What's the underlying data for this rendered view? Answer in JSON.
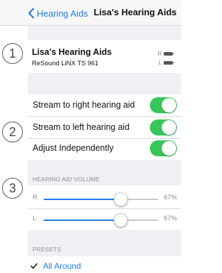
{
  "nav": {
    "back_label": "Hearing Aids",
    "title": "Lisa's Hearing Aids"
  },
  "device": {
    "name": "Lisa's Hearing Aids",
    "model": "ReSound LiNX TS 961",
    "battery_right_label": "R",
    "battery_left_label": "L"
  },
  "streaming": {
    "items": [
      {
        "label": "Stream to right hearing aid",
        "on": true
      },
      {
        "label": "Stream to left hearing aid",
        "on": true
      },
      {
        "label": "Adjust Independently",
        "on": true
      }
    ]
  },
  "volume": {
    "header": "HEARING AID VOLUME",
    "right": {
      "side": "R",
      "percent_label": "67%",
      "value": 0.67
    },
    "left": {
      "side": "L",
      "percent_label": "67%",
      "value": 0.67
    }
  },
  "presets": {
    "header": "PRESETS",
    "selected": "All Around"
  },
  "callouts": [
    "1",
    "2",
    "3"
  ],
  "colors": {
    "accent": "#1a7cf4",
    "toggle_on": "#35c759",
    "grouped_background": "#efeff4"
  }
}
